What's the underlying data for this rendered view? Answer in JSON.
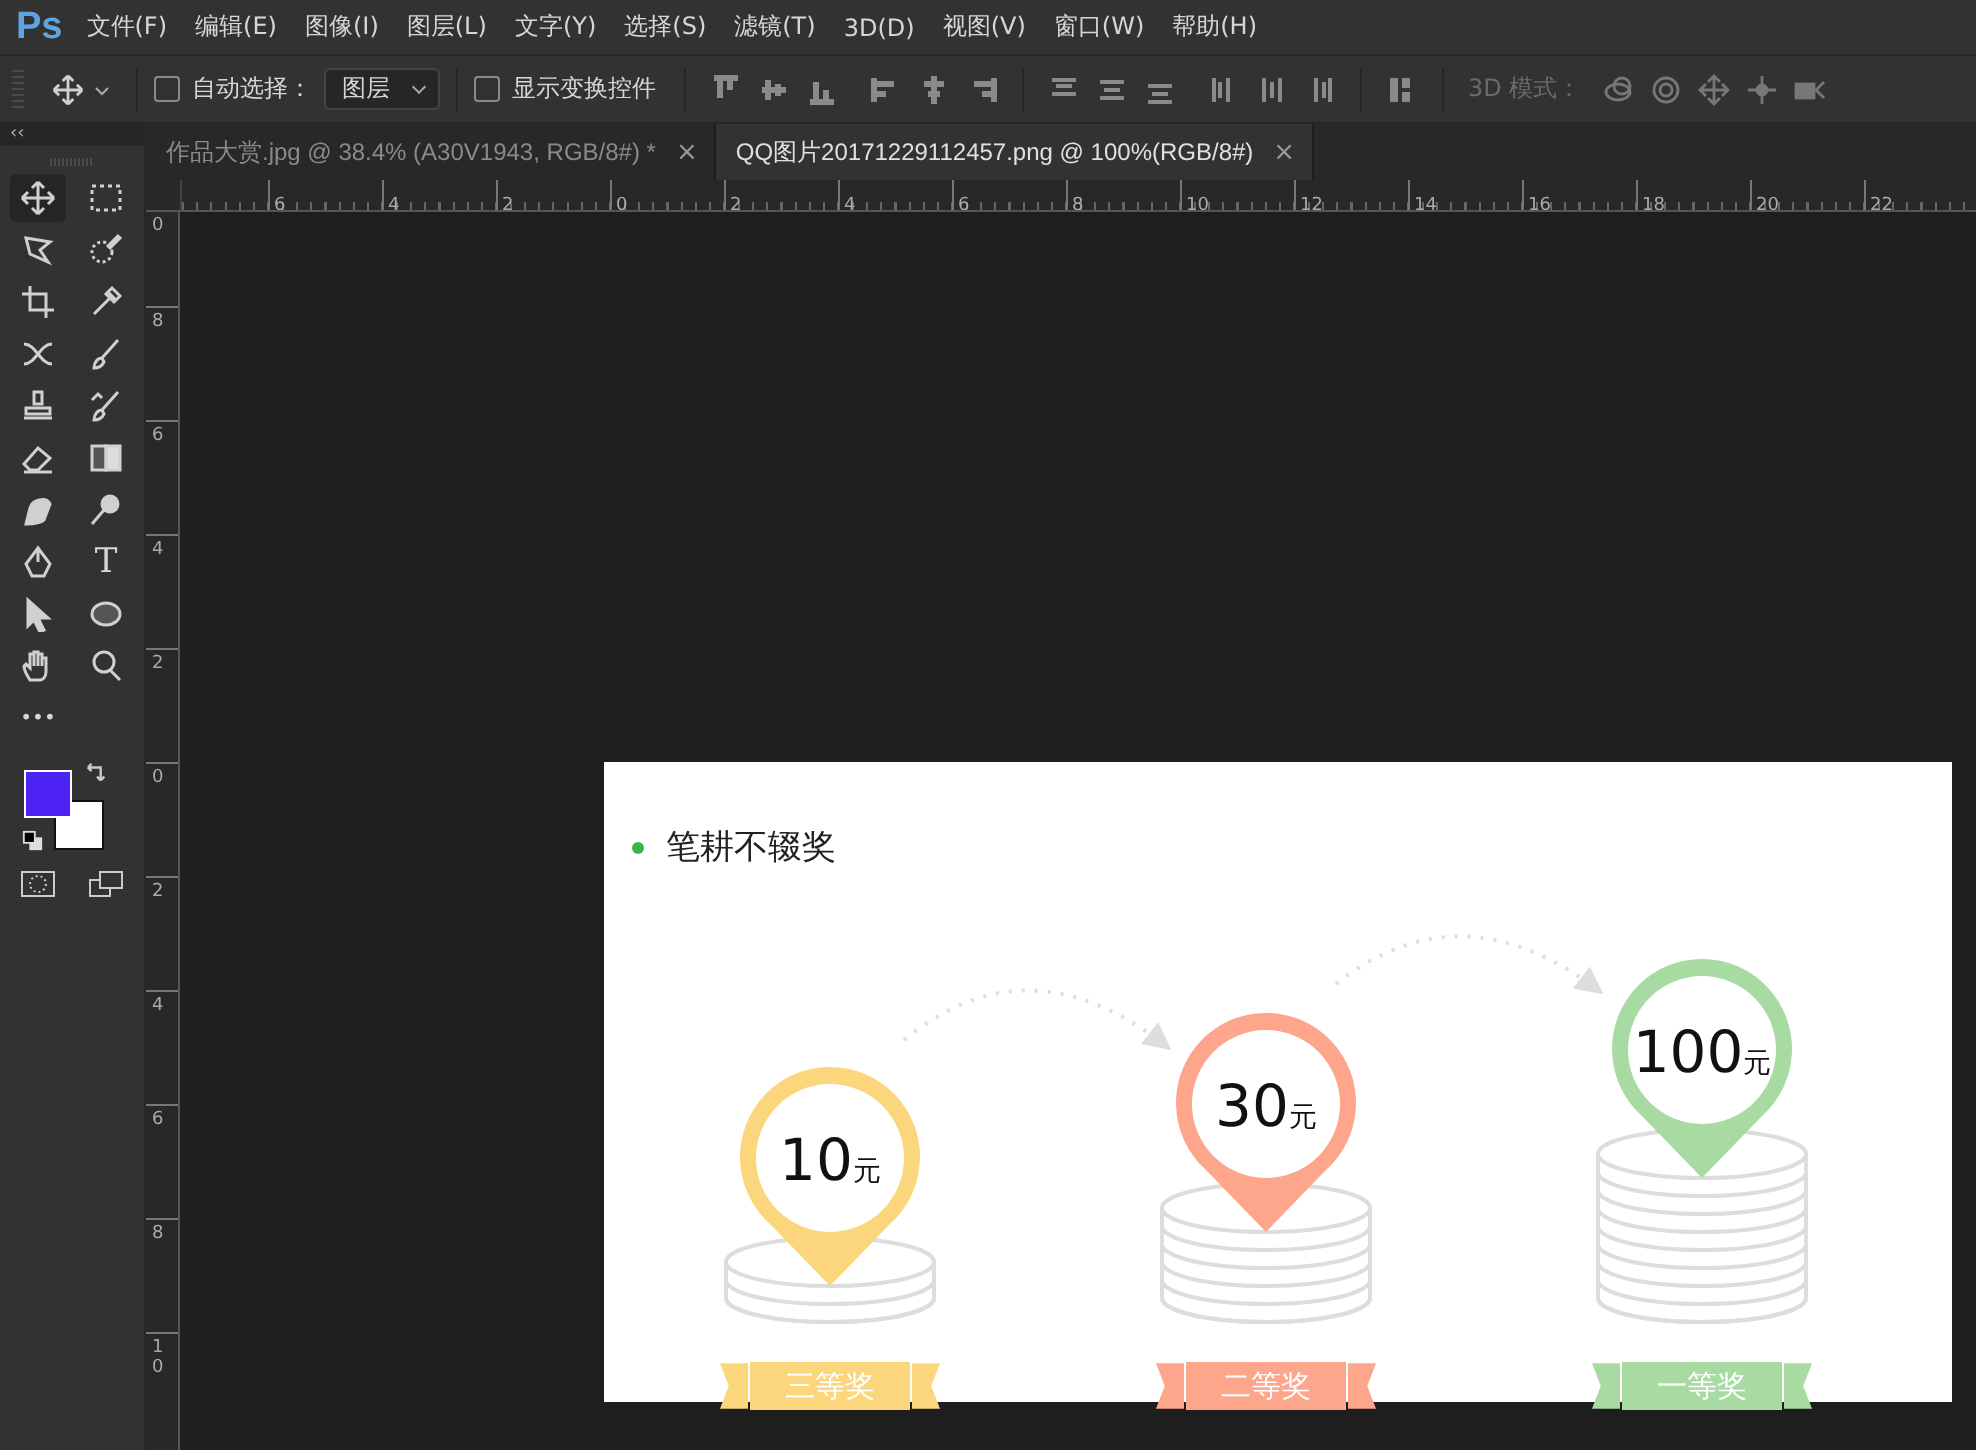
{
  "app_logo": "Ps",
  "menu": [
    "文件(F)",
    "编辑(E)",
    "图像(I)",
    "图层(L)",
    "文字(Y)",
    "选择(S)",
    "滤镜(T)",
    "3D(D)",
    "视图(V)",
    "窗口(W)",
    "帮助(H)"
  ],
  "options_bar": {
    "auto_select": {
      "label": "自动选择：",
      "checked": false
    },
    "auto_select_target": "图层",
    "show_transform": {
      "label": "显示变换控件",
      "checked": false
    },
    "mode_3d_label": "3D 模式："
  },
  "panel_collapse": "‹‹",
  "tabs": [
    {
      "title": "作品大赏.jpg @ 38.4% (A30V1943, RGB/8#) *",
      "close": "×",
      "selected": false
    },
    {
      "title": "QQ图片20171229112457.png @ 100%(RGB/8#)",
      "close": "×",
      "selected": true
    }
  ],
  "tools": [
    {
      "kind": "move",
      "selected": true
    },
    {
      "kind": "marquee",
      "selected": false
    },
    {
      "kind": "lasso",
      "selected": false
    },
    {
      "kind": "quick_select",
      "selected": false
    },
    {
      "kind": "crop",
      "selected": false
    },
    {
      "kind": "eyedropper",
      "selected": false
    },
    {
      "kind": "healing",
      "selected": false
    },
    {
      "kind": "brush",
      "selected": false
    },
    {
      "kind": "stamp",
      "selected": false
    },
    {
      "kind": "history_brush",
      "selected": false
    },
    {
      "kind": "eraser",
      "selected": false
    },
    {
      "kind": "gradient",
      "selected": false
    },
    {
      "kind": "smudge",
      "selected": false
    },
    {
      "kind": "dodge",
      "selected": false
    },
    {
      "kind": "pen",
      "selected": false
    },
    {
      "kind": "type",
      "label": "T",
      "selected": false
    },
    {
      "kind": "path_select",
      "selected": false
    },
    {
      "kind": "ellipse",
      "selected": false
    },
    {
      "kind": "hand",
      "selected": false
    },
    {
      "kind": "zoom",
      "selected": false
    },
    {
      "kind": "more",
      "label": "•••",
      "selected": false
    }
  ],
  "swatches": [
    {
      "kind": "foreground",
      "color": "#4b22f2"
    },
    {
      "kind": "background",
      "color": "#ffffff"
    }
  ],
  "top_ruler": [
    "6",
    "4",
    "2",
    "0",
    "2",
    "4",
    "6",
    "8",
    "10",
    "12",
    "14",
    "16",
    "18",
    "20",
    "22"
  ],
  "left_ruler": [
    "0",
    "8",
    "6",
    "4",
    "2",
    "0",
    "2",
    "4",
    "6",
    "8",
    "10"
  ],
  "image": {
    "title": "笔耕不辍奖",
    "bullet": {
      "color": "#3bb54a"
    },
    "prizes": [
      {
        "amount": "10",
        "unit": "元",
        "label": "三等奖",
        "color": "#fcd67c",
        "kind": "low"
      },
      {
        "amount": "30",
        "unit": "元",
        "label": "二等奖",
        "color": "#fea68c",
        "kind": "mid"
      },
      {
        "amount": "100",
        "unit": "元",
        "label": "一等奖",
        "color": "#a8dba1",
        "kind": "high"
      }
    ]
  }
}
